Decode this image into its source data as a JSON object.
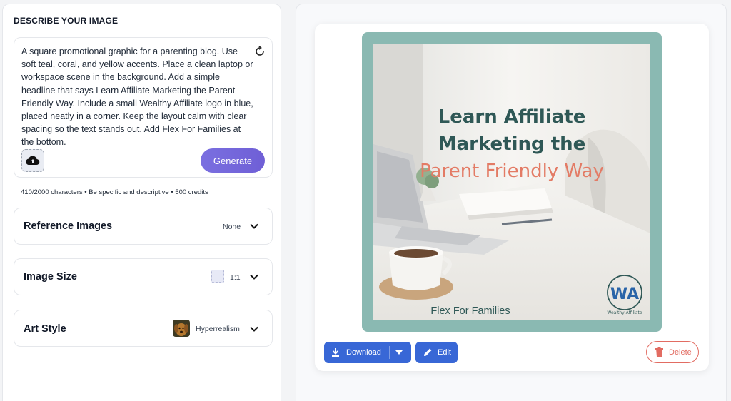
{
  "left": {
    "section_title": "DESCRIBE YOUR IMAGE",
    "prompt_text": "A square promotional graphic for a parenting blog. Use soft teal, coral, and yellow accents. Place a clean laptop or workspace scene in the background. Add a simple headline that says Learn Affiliate Marketing the Parent Friendly Way. Include a small Wealthy Affiliate logo in blue, placed neatly in a corner. Keep the layout calm with clear spacing so the text stands out. Add Flex For Families at the bottom.",
    "generate_label": "Generate",
    "char_info": "410/2000 characters • Be specific and descriptive • 500 credits",
    "reference": {
      "label": "Reference Images",
      "value": "None"
    },
    "size": {
      "label": "Image Size",
      "value": "1:1"
    },
    "style": {
      "label": "Art Style",
      "value": "Hyperrealism"
    }
  },
  "result": {
    "headline_line1": "Learn Affiliate",
    "headline_line2": "Marketing the",
    "headline_line3": "Parent Friendly Way",
    "footer": "Flex For Families",
    "logo_initials": "WA",
    "logo_text": "Wealthy Affiliate",
    "download_label": "Download",
    "edit_label": "Edit",
    "delete_label": "Delete"
  },
  "colors": {
    "accent": "#3867d6",
    "generate": "#7a6fe0",
    "frame": "#8ab9b2",
    "headline": "#2f5856",
    "coral": "#e37b65",
    "delete": "#e26c62"
  }
}
